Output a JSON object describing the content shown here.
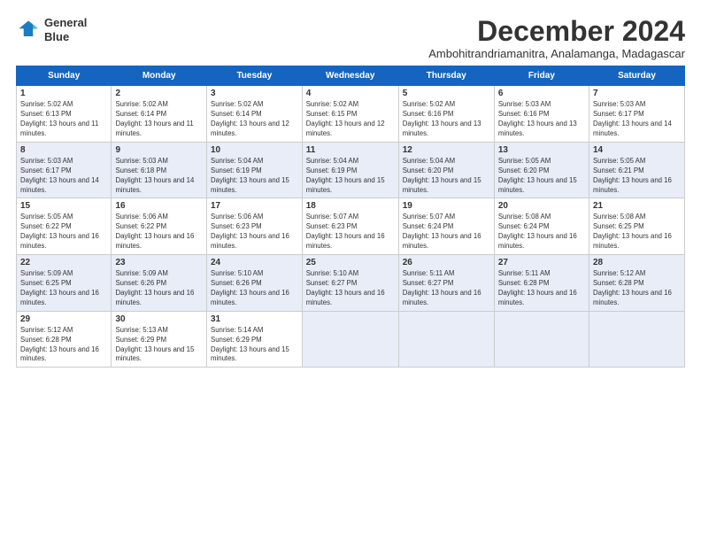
{
  "logo": {
    "line1": "General",
    "line2": "Blue"
  },
  "title": "December 2024",
  "subtitle": "Ambohitrandriamanitra, Analamanga, Madagascar",
  "days_header": [
    "Sunday",
    "Monday",
    "Tuesday",
    "Wednesday",
    "Thursday",
    "Friday",
    "Saturday"
  ],
  "weeks": [
    [
      {
        "day": "1",
        "sunrise": "Sunrise: 5:02 AM",
        "sunset": "Sunset: 6:13 PM",
        "daylight": "Daylight: 13 hours and 11 minutes."
      },
      {
        "day": "2",
        "sunrise": "Sunrise: 5:02 AM",
        "sunset": "Sunset: 6:14 PM",
        "daylight": "Daylight: 13 hours and 11 minutes."
      },
      {
        "day": "3",
        "sunrise": "Sunrise: 5:02 AM",
        "sunset": "Sunset: 6:14 PM",
        "daylight": "Daylight: 13 hours and 12 minutes."
      },
      {
        "day": "4",
        "sunrise": "Sunrise: 5:02 AM",
        "sunset": "Sunset: 6:15 PM",
        "daylight": "Daylight: 13 hours and 12 minutes."
      },
      {
        "day": "5",
        "sunrise": "Sunrise: 5:02 AM",
        "sunset": "Sunset: 6:16 PM",
        "daylight": "Daylight: 13 hours and 13 minutes."
      },
      {
        "day": "6",
        "sunrise": "Sunrise: 5:03 AM",
        "sunset": "Sunset: 6:16 PM",
        "daylight": "Daylight: 13 hours and 13 minutes."
      },
      {
        "day": "7",
        "sunrise": "Sunrise: 5:03 AM",
        "sunset": "Sunset: 6:17 PM",
        "daylight": "Daylight: 13 hours and 14 minutes."
      }
    ],
    [
      {
        "day": "8",
        "sunrise": "Sunrise: 5:03 AM",
        "sunset": "Sunset: 6:17 PM",
        "daylight": "Daylight: 13 hours and 14 minutes."
      },
      {
        "day": "9",
        "sunrise": "Sunrise: 5:03 AM",
        "sunset": "Sunset: 6:18 PM",
        "daylight": "Daylight: 13 hours and 14 minutes."
      },
      {
        "day": "10",
        "sunrise": "Sunrise: 5:04 AM",
        "sunset": "Sunset: 6:19 PM",
        "daylight": "Daylight: 13 hours and 15 minutes."
      },
      {
        "day": "11",
        "sunrise": "Sunrise: 5:04 AM",
        "sunset": "Sunset: 6:19 PM",
        "daylight": "Daylight: 13 hours and 15 minutes."
      },
      {
        "day": "12",
        "sunrise": "Sunrise: 5:04 AM",
        "sunset": "Sunset: 6:20 PM",
        "daylight": "Daylight: 13 hours and 15 minutes."
      },
      {
        "day": "13",
        "sunrise": "Sunrise: 5:05 AM",
        "sunset": "Sunset: 6:20 PM",
        "daylight": "Daylight: 13 hours and 15 minutes."
      },
      {
        "day": "14",
        "sunrise": "Sunrise: 5:05 AM",
        "sunset": "Sunset: 6:21 PM",
        "daylight": "Daylight: 13 hours and 16 minutes."
      }
    ],
    [
      {
        "day": "15",
        "sunrise": "Sunrise: 5:05 AM",
        "sunset": "Sunset: 6:22 PM",
        "daylight": "Daylight: 13 hours and 16 minutes."
      },
      {
        "day": "16",
        "sunrise": "Sunrise: 5:06 AM",
        "sunset": "Sunset: 6:22 PM",
        "daylight": "Daylight: 13 hours and 16 minutes."
      },
      {
        "day": "17",
        "sunrise": "Sunrise: 5:06 AM",
        "sunset": "Sunset: 6:23 PM",
        "daylight": "Daylight: 13 hours and 16 minutes."
      },
      {
        "day": "18",
        "sunrise": "Sunrise: 5:07 AM",
        "sunset": "Sunset: 6:23 PM",
        "daylight": "Daylight: 13 hours and 16 minutes."
      },
      {
        "day": "19",
        "sunrise": "Sunrise: 5:07 AM",
        "sunset": "Sunset: 6:24 PM",
        "daylight": "Daylight: 13 hours and 16 minutes."
      },
      {
        "day": "20",
        "sunrise": "Sunrise: 5:08 AM",
        "sunset": "Sunset: 6:24 PM",
        "daylight": "Daylight: 13 hours and 16 minutes."
      },
      {
        "day": "21",
        "sunrise": "Sunrise: 5:08 AM",
        "sunset": "Sunset: 6:25 PM",
        "daylight": "Daylight: 13 hours and 16 minutes."
      }
    ],
    [
      {
        "day": "22",
        "sunrise": "Sunrise: 5:09 AM",
        "sunset": "Sunset: 6:25 PM",
        "daylight": "Daylight: 13 hours and 16 minutes."
      },
      {
        "day": "23",
        "sunrise": "Sunrise: 5:09 AM",
        "sunset": "Sunset: 6:26 PM",
        "daylight": "Daylight: 13 hours and 16 minutes."
      },
      {
        "day": "24",
        "sunrise": "Sunrise: 5:10 AM",
        "sunset": "Sunset: 6:26 PM",
        "daylight": "Daylight: 13 hours and 16 minutes."
      },
      {
        "day": "25",
        "sunrise": "Sunrise: 5:10 AM",
        "sunset": "Sunset: 6:27 PM",
        "daylight": "Daylight: 13 hours and 16 minutes."
      },
      {
        "day": "26",
        "sunrise": "Sunrise: 5:11 AM",
        "sunset": "Sunset: 6:27 PM",
        "daylight": "Daylight: 13 hours and 16 minutes."
      },
      {
        "day": "27",
        "sunrise": "Sunrise: 5:11 AM",
        "sunset": "Sunset: 6:28 PM",
        "daylight": "Daylight: 13 hours and 16 minutes."
      },
      {
        "day": "28",
        "sunrise": "Sunrise: 5:12 AM",
        "sunset": "Sunset: 6:28 PM",
        "daylight": "Daylight: 13 hours and 16 minutes."
      }
    ],
    [
      {
        "day": "29",
        "sunrise": "Sunrise: 5:12 AM",
        "sunset": "Sunset: 6:28 PM",
        "daylight": "Daylight: 13 hours and 16 minutes."
      },
      {
        "day": "30",
        "sunrise": "Sunrise: 5:13 AM",
        "sunset": "Sunset: 6:29 PM",
        "daylight": "Daylight: 13 hours and 15 minutes."
      },
      {
        "day": "31",
        "sunrise": "Sunrise: 5:14 AM",
        "sunset": "Sunset: 6:29 PM",
        "daylight": "Daylight: 13 hours and 15 minutes."
      },
      null,
      null,
      null,
      null
    ]
  ]
}
